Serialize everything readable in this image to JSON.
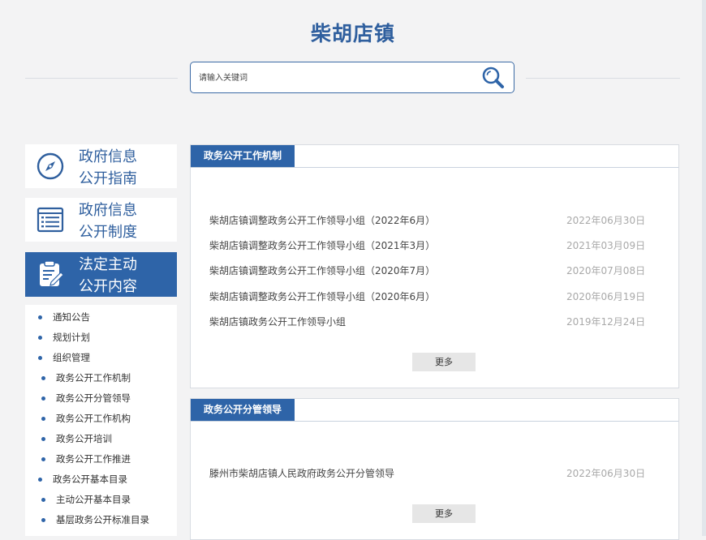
{
  "header": {
    "title": "柴胡店镇"
  },
  "search": {
    "placeholder": "请输入关键词"
  },
  "sidebar": {
    "cards": [
      {
        "label_line1": "政府信息",
        "label_line2": "公开指南",
        "icon": "compass-icon",
        "active": false
      },
      {
        "label_line1": "政府信息",
        "label_line2": "公开制度",
        "icon": "list-document-icon",
        "active": false
      },
      {
        "label_line1": "法定主动",
        "label_line2": "公开内容",
        "icon": "clipboard-edit-icon",
        "active": true
      }
    ],
    "items": [
      {
        "label": "通知公告",
        "level": 1
      },
      {
        "label": "规划计划",
        "level": 1
      },
      {
        "label": "组织管理",
        "level": 1
      },
      {
        "label": "政务公开工作机制",
        "level": 2
      },
      {
        "label": "政务公开分管领导",
        "level": 2
      },
      {
        "label": "政务公开工作机构",
        "level": 2
      },
      {
        "label": "政务公开培训",
        "level": 2
      },
      {
        "label": "政务公开工作推进",
        "level": 2
      },
      {
        "label": "政务公开基本目录",
        "level": 1
      },
      {
        "label": "主动公开基本目录",
        "level": 2
      },
      {
        "label": "基层政务公开标准目录",
        "level": 2
      }
    ]
  },
  "panels": [
    {
      "title": "政务公开工作机制",
      "rows": [
        {
          "title": "柴胡店镇调整政务公开工作领导小组（2022年6月）",
          "date": "2022年06月30日"
        },
        {
          "title": "柴胡店镇调整政务公开工作领导小组（2021年3月）",
          "date": "2021年03月09日"
        },
        {
          "title": "柴胡店镇调整政务公开工作领导小组（2020年7月）",
          "date": "2020年07月08日"
        },
        {
          "title": "柴胡店镇调整政务公开工作领导小组（2020年6月）",
          "date": "2020年06月19日"
        },
        {
          "title": "柴胡店镇政务公开工作领导小组",
          "date": "2019年12月24日"
        }
      ],
      "more": "更多"
    },
    {
      "title": "政务公开分管领导",
      "rows": [
        {
          "title": "滕州市柴胡店镇人民政府政务公开分管领导",
          "date": "2022年06月30日"
        }
      ],
      "more": "更多"
    }
  ],
  "colors": {
    "brand": "#2e64a8",
    "title": "#2f5f9e",
    "background": "#f3f3f4",
    "date": "#a9a9a9"
  }
}
